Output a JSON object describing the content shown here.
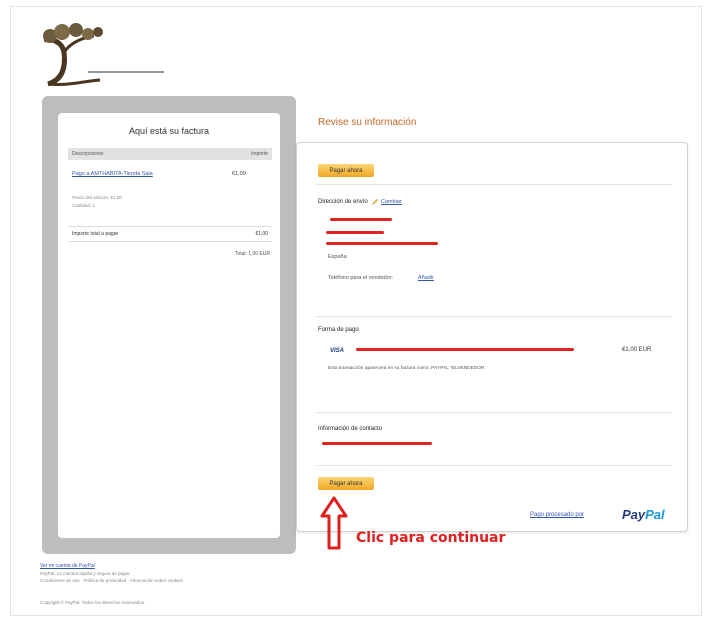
{
  "invoice": {
    "title": "Aquí está su factura",
    "col_description": "Descripciones",
    "col_amount": "Importe",
    "item_link": "Pago a AMTHABITA-Tienda Sala",
    "item_price": "€1,00",
    "item_unit_price": "Precio del artículo: €1,00",
    "item_quantity": "Cantidad: 1",
    "total_label": "Importe total a pagar",
    "total_value": "€1,00",
    "total_footer": "Total: 1,00 EUR"
  },
  "review": {
    "heading": "Revise su información",
    "pay_now_label": "Pagar ahora",
    "shipping_label": "Dirección de envío",
    "shipping_change": "Cambiar",
    "country": "España",
    "phone_label": "Teléfono para el vendedor:",
    "phone_link": "Añadir",
    "payment_method_label": "Forma de pago",
    "card_brand": "VISA",
    "amount": "€1,00 EUR",
    "payment_note": "Esta transacción aparecerá en su factura como: PAYPAL *ELVENDEDOR",
    "contact_label": "Información de contacto",
    "paypal_note": "Pago procesado por",
    "paypal_logo_part1": "Pay",
    "paypal_logo_part2": "Pal"
  },
  "annotation": {
    "text": "Clic para continuar",
    "color": "#e01f1f"
  },
  "footer": {
    "link": "Ver mi cuenta de PayPal",
    "text1": "PayPal. La manera rápida y segura de pagar.",
    "text2": "Condiciones de uso · Política de privacidad · Información sobre cookies",
    "copyright": "Copyright © PayPal. Todos los derechos reservados."
  },
  "colors": {
    "accent_orange": "#c0672c",
    "button_gradient_top": "#fbd676",
    "button_gradient_bottom": "#f1a623",
    "link_blue": "#3355aa",
    "redaction_red": "#e32222",
    "paypal_dark": "#253b80",
    "paypal_light": "#179bd7"
  },
  "icons": [
    "tree-logo-icon",
    "pencil-icon",
    "visa-logo-icon",
    "up-arrow-icon"
  ]
}
